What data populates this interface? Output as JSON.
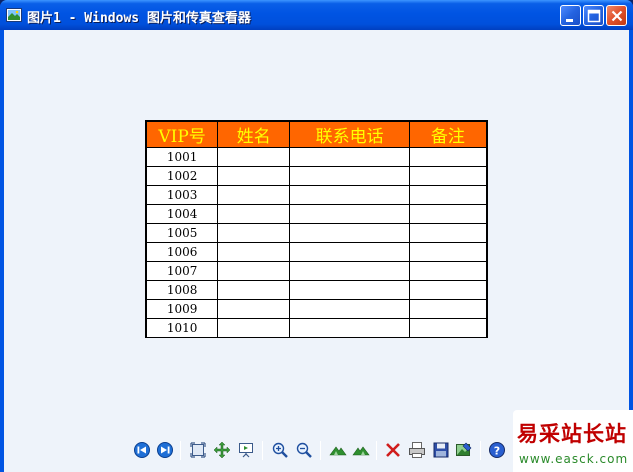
{
  "window": {
    "title": "图片1 - Windows 图片和传真查看器",
    "controls": [
      "minimize",
      "maximize",
      "close"
    ]
  },
  "table": {
    "headers": [
      "VIP号",
      "姓名",
      "联系电话",
      "备注"
    ],
    "rows": [
      [
        "1001",
        "",
        "",
        ""
      ],
      [
        "1002",
        "",
        "",
        ""
      ],
      [
        "1003",
        "",
        "",
        ""
      ],
      [
        "1004",
        "",
        "",
        ""
      ],
      [
        "1005",
        "",
        "",
        ""
      ],
      [
        "1006",
        "",
        "",
        ""
      ],
      [
        "1007",
        "",
        "",
        ""
      ],
      [
        "1008",
        "",
        "",
        ""
      ],
      [
        "1009",
        "",
        "",
        ""
      ],
      [
        "1010",
        "",
        "",
        ""
      ]
    ],
    "header_bg": "#ff6600",
    "header_text": "#ffff00"
  },
  "toolbar": {
    "buttons": [
      "previous-image-icon",
      "next-image-icon",
      "best-fit-icon",
      "actual-size-icon",
      "slideshow-icon",
      "zoom-in-icon",
      "zoom-out-icon",
      "rotate-clockwise-icon",
      "rotate-counterclockwise-icon",
      "delete-icon",
      "print-icon",
      "save-icon",
      "open-editor-icon",
      "help-icon"
    ]
  },
  "watermark": {
    "title": "易采站长站",
    "url": "www.easck.com"
  }
}
